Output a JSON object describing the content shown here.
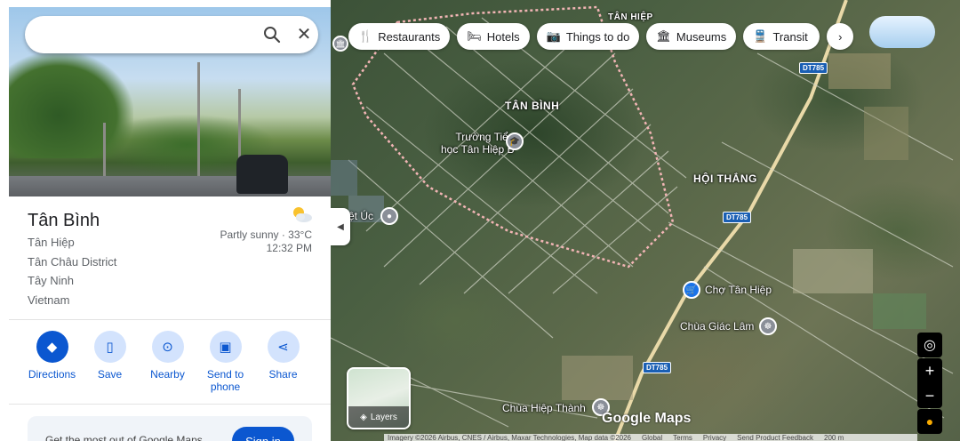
{
  "search": {
    "placeholder": "",
    "value": ""
  },
  "place": {
    "title": "Tân Bình",
    "address_lines": [
      "Tân Hiệp",
      "Tân Châu District",
      "Tây Ninh",
      "Vietnam"
    ],
    "weather": {
      "condition": "Partly sunny · 33°C",
      "time": "12:32 PM",
      "icon": "partly-sunny-icon"
    }
  },
  "actions": [
    {
      "label": "Directions",
      "icon": "directions-icon"
    },
    {
      "label": "Save",
      "icon": "bookmark-icon"
    },
    {
      "label": "Nearby",
      "icon": "nearby-icon"
    },
    {
      "label": "Send to\nphone",
      "icon": "phone-icon"
    },
    {
      "label": "Share",
      "icon": "share-icon"
    }
  ],
  "signin": {
    "text": "Get the most out of Google Maps",
    "button": "Sign in"
  },
  "chips": [
    {
      "label": "Restaurants",
      "icon": "restaurant-icon"
    },
    {
      "label": "Hotels",
      "icon": "hotel-icon"
    },
    {
      "label": "Things to do",
      "icon": "camera-icon"
    },
    {
      "label": "Museums",
      "icon": "museum-icon"
    },
    {
      "label": "Transit",
      "icon": "transit-icon"
    }
  ],
  "map": {
    "area_labels": [
      "TÂN HIỆP",
      "TÂN BÌNH",
      "HỘI THẮNG"
    ],
    "pois": [
      {
        "label": "Trường Tiểu\nhọc Tân Hiệp B",
        "icon": "school-icon"
      },
      {
        "label": "ệt Úc",
        "icon": "place-icon"
      },
      {
        "label": "Chợ Tân Hiệp",
        "icon": "shopping-cart-icon"
      },
      {
        "label": "Chùa Giác Lâm",
        "icon": "temple-icon"
      },
      {
        "label": "Chùa Hiệp Thành",
        "icon": "temple-icon"
      }
    ],
    "road_shields": [
      "DT785",
      "DT785",
      "DT785"
    ],
    "layers_label": "Layers",
    "watermark": "Google Maps",
    "attribution": [
      "Imagery ©2026 Airbus, CNES / Airbus, Maxar Technologies, Map data ©2026",
      "Global",
      "Terms",
      "Privacy",
      "Send Product Feedback",
      "200 m"
    ],
    "boundary_color": "#e8a0a0"
  }
}
